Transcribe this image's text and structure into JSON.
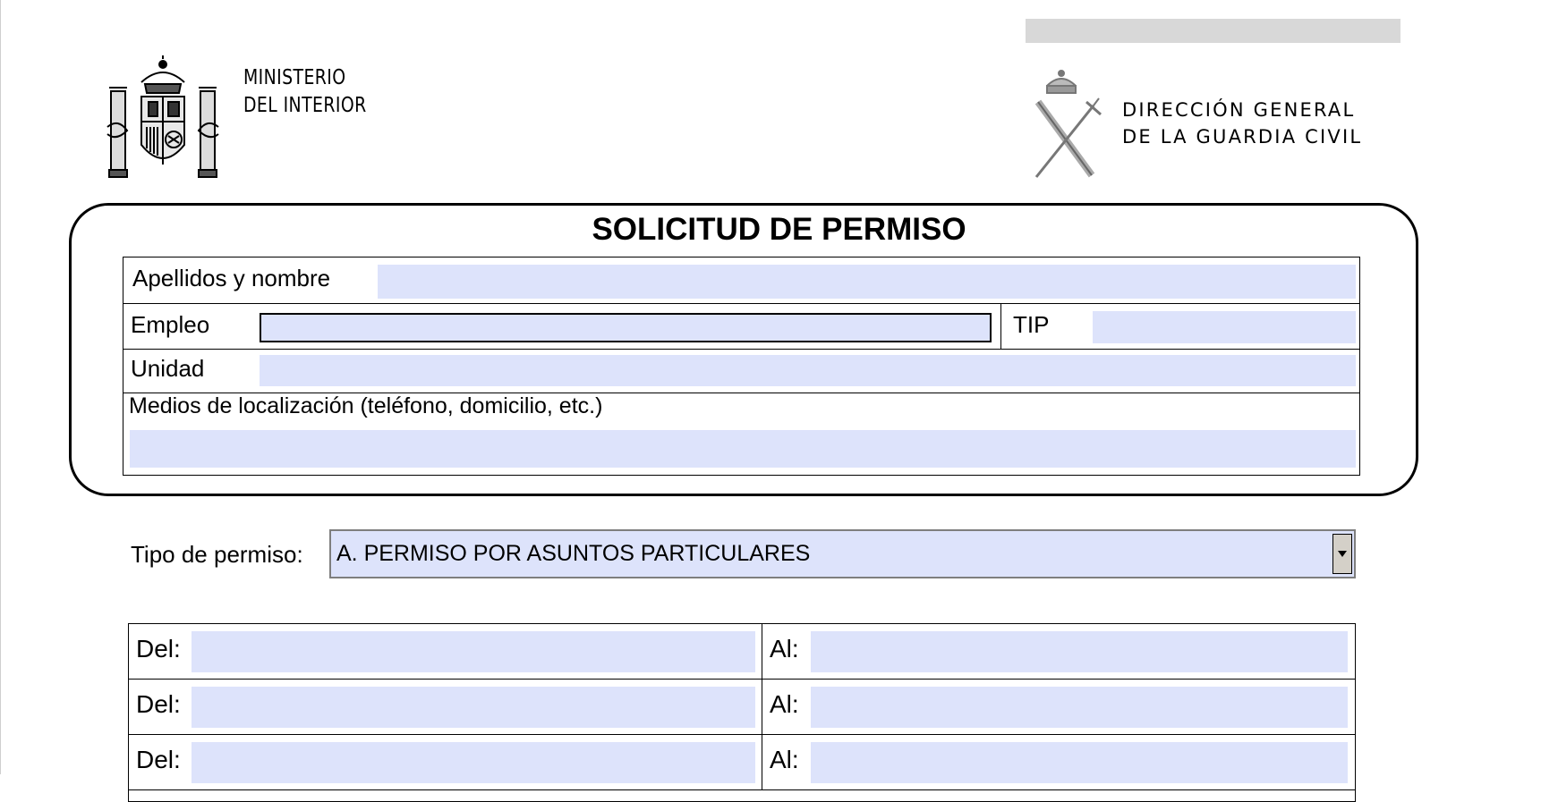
{
  "header": {
    "ministry_line1": "MINISTERIO",
    "ministry_line2": "DEL INTERIOR",
    "directorate_line1": "DIRECCIÓN GENERAL",
    "directorate_line2": "DE LA GUARDIA CIVIL"
  },
  "form": {
    "title": "SOLICITUD DE PERMISO",
    "fields": {
      "apellidos_label": "Apellidos y nombre",
      "apellidos_value": "",
      "empleo_label": "Empleo",
      "empleo_value": "",
      "tip_label": "TIP",
      "tip_value": "",
      "unidad_label": "Unidad",
      "unidad_value": "",
      "medios_label": "Medios de localización (teléfono, domicilio, etc.)",
      "medios_value": ""
    },
    "tipo_permiso": {
      "label": "Tipo de permiso:",
      "selected": "A. PERMISO POR ASUNTOS PARTICULARES"
    },
    "date_rows": [
      {
        "del_label": "Del:",
        "del_value": "",
        "al_label": "Al:",
        "al_value": ""
      },
      {
        "del_label": "Del:",
        "del_value": "",
        "al_label": "Al:",
        "al_value": ""
      },
      {
        "del_label": "Del:",
        "del_value": "",
        "al_label": "Al:",
        "al_value": ""
      }
    ]
  },
  "colors": {
    "field_fill": "#dde3fb",
    "header_bar": "#d8d8d8"
  }
}
